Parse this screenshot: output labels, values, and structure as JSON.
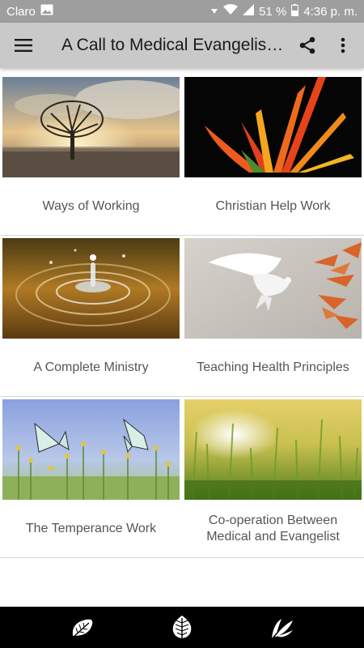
{
  "status_bar": {
    "carrier": "Claro",
    "battery": "51 %",
    "time": "4:36 p. m."
  },
  "app_bar": {
    "title": "A Call to Medical Evangelis…"
  },
  "cards": [
    {
      "label": "Ways of Working",
      "image": "tree-sunset"
    },
    {
      "label": "Christian Help Work",
      "image": "orange-flower"
    },
    {
      "label": "A Complete Ministry",
      "image": "water-drop"
    },
    {
      "label": "Teaching Health Principles",
      "image": "white-dove"
    },
    {
      "label": "The Temperance Work",
      "image": "butterflies"
    },
    {
      "label": "Co-operation Between Medical and Evangelist",
      "image": "wheat-field"
    }
  ],
  "bottom_nav": [
    "leaf-icon",
    "leaf-round-icon",
    "leaf-branch-icon"
  ]
}
